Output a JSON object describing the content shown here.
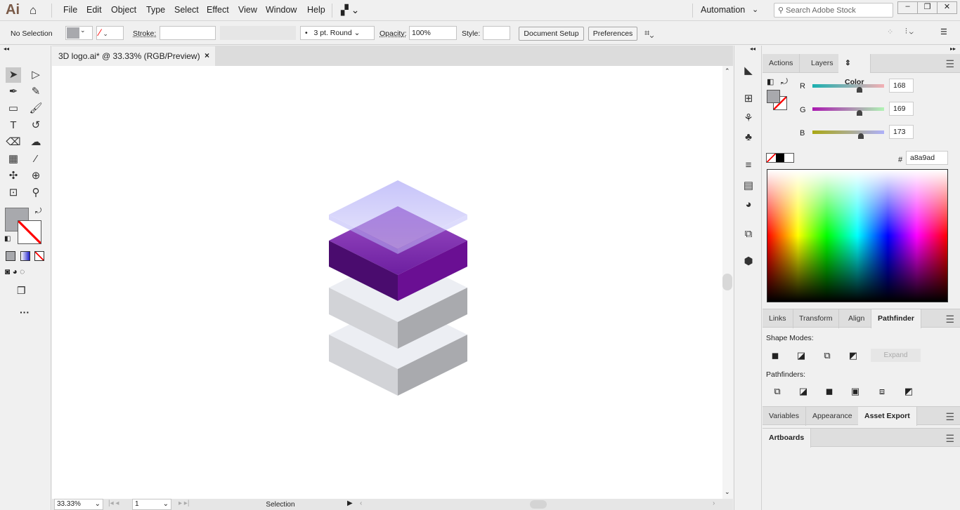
{
  "app": {
    "logo": "Ai",
    "menus": [
      "File",
      "Edit",
      "Object",
      "Type",
      "Select",
      "Effect",
      "View",
      "Window",
      "Help"
    ],
    "workspace": "Automation",
    "search_placeholder": "Search Adobe Stock"
  },
  "control": {
    "selection": "No Selection",
    "stroke_label": "Stroke:",
    "brush": "3 pt. Round",
    "opacity_label": "Opacity:",
    "opacity": "100%",
    "style_label": "Style:",
    "document_setup": "Document Setup",
    "preferences": "Preferences"
  },
  "document": {
    "tab_title": "3D logo.ai* @ 33.33% (RGB/Preview)"
  },
  "status": {
    "zoom": "33.33%",
    "artboard": "1",
    "tool": "Selection"
  },
  "panels": {
    "top_tabs": [
      "Actions",
      "Layers",
      "Color"
    ],
    "color": {
      "r": "168",
      "g": "169",
      "b": "173",
      "hex": "a8a9ad",
      "hash": "#",
      "r_label": "R",
      "g_label": "G",
      "b_label": "B",
      "r_level": 0.66,
      "g_level": 0.66,
      "b_level": 0.68,
      "fill": "#a8a9ad"
    },
    "mid_tabs": [
      "Links",
      "Transform",
      "Align",
      "Pathfinder"
    ],
    "pathfinder": {
      "shape_modes": "Shape Modes:",
      "expand": "Expand",
      "pathfinders": "Pathfinders:"
    },
    "bottom_tabs": [
      "Variables",
      "Appearance",
      "Asset Export"
    ],
    "artboards_tab": "Artboards"
  },
  "colors": {
    "purple": "#6a1b9a",
    "glass": "#a7a3f5",
    "slab": "#c8c9cd"
  }
}
